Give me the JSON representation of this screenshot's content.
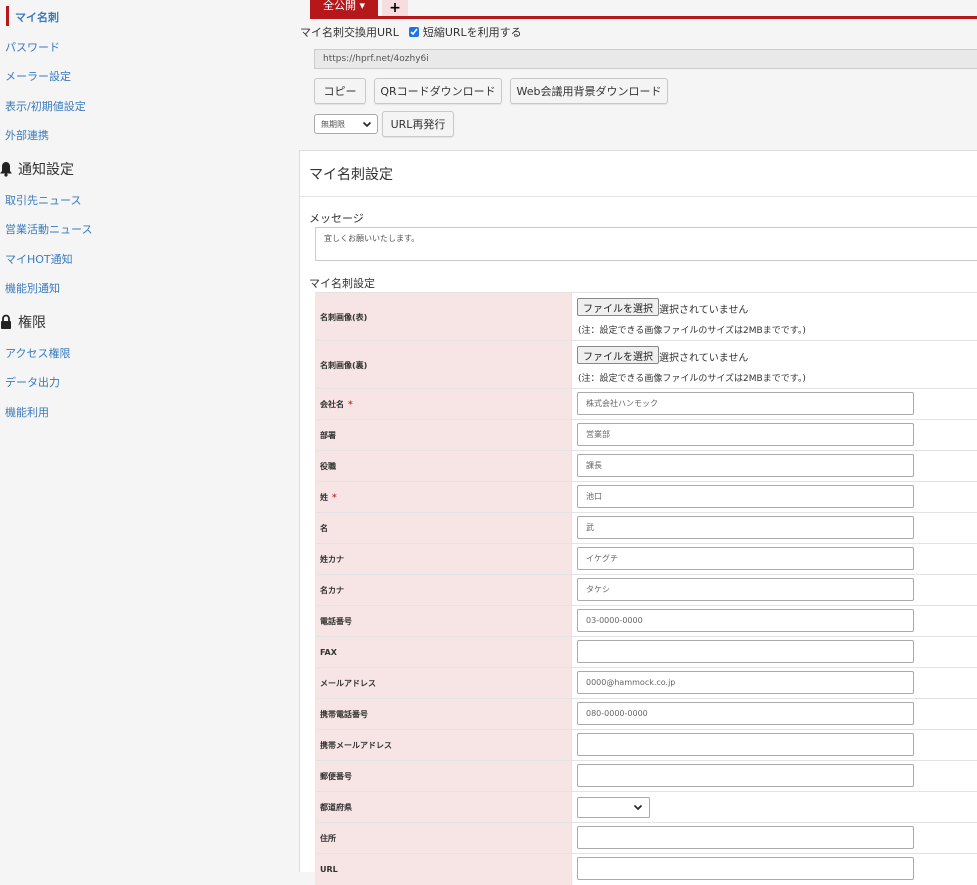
{
  "sidebar": {
    "items_top": [
      "マイ名刺",
      "パスワード",
      "メーラー設定",
      "表示/初期値設定",
      "外部連携"
    ],
    "section_notify": "通知設定",
    "items_notify": [
      "取引先ニュース",
      "営業活動ニュース",
      "マイHOT通知",
      "機能別通知"
    ],
    "section_perm": "権限",
    "items_perm": [
      "アクセス権限",
      "データ出力",
      "機能利用"
    ]
  },
  "topbar": {
    "tab_label": "全公開 ▾",
    "plus_label": "+"
  },
  "share": {
    "url_label": "マイ名刺交換用URL",
    "short_url_label": "短縮URLを利用する",
    "short_url_checked": true,
    "url_value": "https://hprf.net/4ozhy6i",
    "btn_copy": "コピー",
    "btn_qr": "QRコードダウンロード",
    "btn_bg": "Web会議用背景ダウンロード",
    "expiry_value": "無期限",
    "btn_reissue": "URL再発行"
  },
  "panel": {
    "title": "マイ名刺設定",
    "message_label": "メッセージ",
    "message_value": "宜しくお願いいたします。",
    "sub_label": "マイ名刺設定"
  },
  "form": {
    "file_button": "ファイルを選択",
    "file_status": "選択されていません",
    "file_note": "(注：設定できる画像ファイルのサイズは2MBまでです。)",
    "rows": [
      {
        "label": "名刺画像(表)"
      },
      {
        "label": "名刺画像(裏)"
      },
      {
        "label": "会社名",
        "value": "株式会社ハンモック"
      },
      {
        "label": "部署",
        "value": "営業部"
      },
      {
        "label": "役職",
        "value": "課長"
      },
      {
        "label": "姓",
        "value": "池口"
      },
      {
        "label": "名",
        "value": "武"
      },
      {
        "label": "姓カナ",
        "value": "イケグチ"
      },
      {
        "label": "名カナ",
        "value": "タケシ"
      },
      {
        "label": "電話番号",
        "value": "03-0000-0000"
      },
      {
        "label": "FAX",
        "value": ""
      },
      {
        "label": "メールアドレス",
        "value": "0000@hammock.co.jp"
      },
      {
        "label": "携帯電話番号",
        "value": "080-0000-0000"
      },
      {
        "label": "携帯メールアドレス",
        "value": ""
      },
      {
        "label": "郵便番号",
        "value": ""
      },
      {
        "label": "都道府県",
        "value": ""
      },
      {
        "label": "住所",
        "value": ""
      },
      {
        "label": "URL",
        "value": ""
      }
    ],
    "required_mark": "*"
  },
  "colors": {
    "accent": "#b5171b",
    "link": "#3b7bbf",
    "label_bg": "#f7e4e4"
  }
}
